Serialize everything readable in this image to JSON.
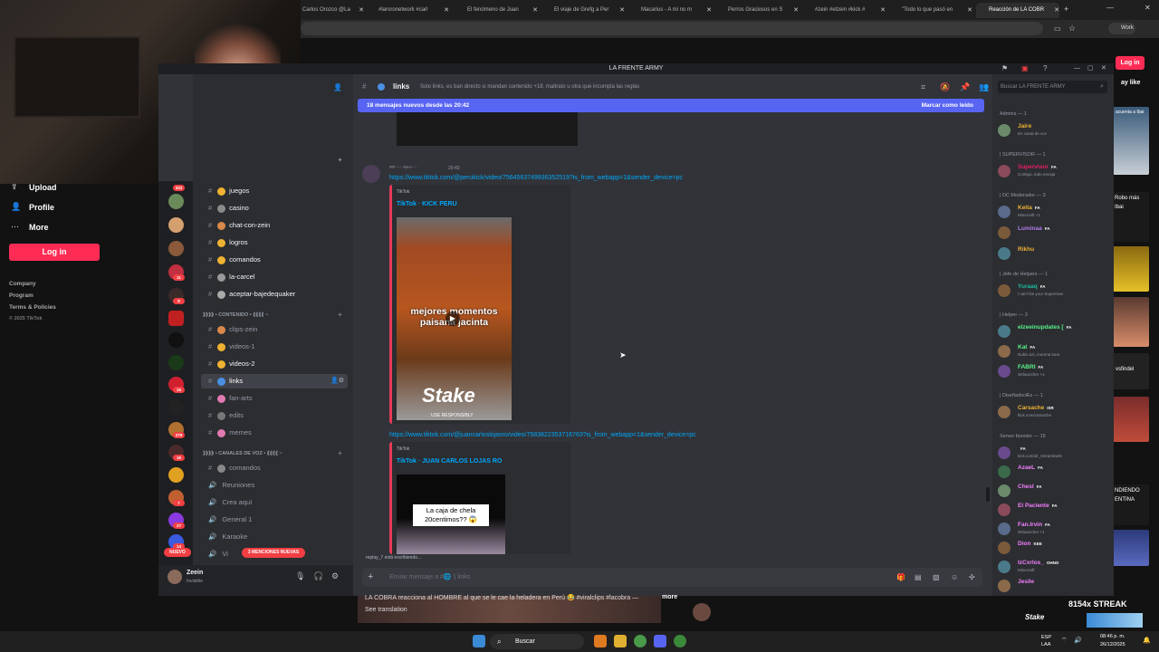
{
  "browser": {
    "tabs": [
      {
        "label": "Carlos Orozco @La"
      },
      {
        "label": "#laroronetwork #carl"
      },
      {
        "label": "El fenómeno de Juan"
      },
      {
        "label": "El viaje de Grefg a Per"
      },
      {
        "label": "Macarius - A mi no m"
      },
      {
        "label": "Perros Graciosos en S"
      },
      {
        "label": "#zein #elzein #kick #"
      },
      {
        "label": "\"Todo lo que pasó en"
      },
      {
        "label": "Reacción de LA COBR"
      }
    ],
    "profile_label": "Work",
    "login_label": "Log in"
  },
  "tiktok": {
    "nav": [
      {
        "label": "Upload",
        "icon": "upload-icon"
      },
      {
        "label": "Profile",
        "icon": "person-icon"
      },
      {
        "label": "More",
        "icon": "more-icon"
      }
    ],
    "login_button": "Log in",
    "footer": [
      "Company",
      "Program",
      "Terms & Policies",
      "© 2025 TikTok"
    ],
    "caption": "LA COBRA reacciona al HOMBRE al que se le cae la heladera en Perú 😂 #viralclips #lacobra —",
    "caption_more": "more",
    "see_translation": "See translation",
    "streak": "8154x STREAK",
    "right_thumbs": [
      "acuenta a Ibai",
      "ay like",
      "Robo más",
      "Ibai",
      "NDIENDO",
      "ENTINA",
      "vsfindel"
    ]
  },
  "discord": {
    "window_title": "LA FRENTE ARMY",
    "server_badges": [
      "333",
      "11",
      "8",
      "15",
      "279",
      "16",
      "7",
      "27",
      "14",
      "NUEVO"
    ],
    "categories": {
      "contenido": "⟫⟫⟫⟫ • CONTENIDO • ⟪⟪⟪⟪ ~",
      "voz": "⟫⟫⟫⟫ • CANALES DE VOZ • ⟪⟪⟪⟪ ~"
    },
    "channels_top": [
      {
        "name": "juegos",
        "icon": "hash"
      },
      {
        "name": "casino",
        "icon": "hash"
      },
      {
        "name": "chat-con-zein",
        "icon": "hash"
      },
      {
        "name": "logros",
        "icon": "hash"
      },
      {
        "name": "comandos",
        "icon": "hash"
      },
      {
        "name": "la-carcel",
        "icon": "hash"
      },
      {
        "name": "aceptar-bajedequaker",
        "icon": "hash"
      }
    ],
    "channels_content": [
      {
        "name": "clips-zein"
      },
      {
        "name": "videos-1"
      },
      {
        "name": "videos-2"
      },
      {
        "name": "links"
      },
      {
        "name": "fan-arts"
      },
      {
        "name": "edits"
      },
      {
        "name": "memes"
      }
    ],
    "channels_voice": [
      {
        "name": "comandos"
      },
      {
        "name": "Reuniones"
      },
      {
        "name": "Crea aquí"
      },
      {
        "name": "General 1"
      },
      {
        "name": "Karaoke"
      },
      {
        "name": "Vi"
      }
    ],
    "mentions_pill": "3 MENCIONES NUEVAS",
    "new_pill": "NUEVO",
    "user": {
      "name": "Zeein",
      "status": "Invisible"
    },
    "channel": {
      "name": "links",
      "topic": "Solo links, es ban directo si mandan contenido +18, maltrato u otra que incumpla las reglas"
    },
    "new_messages": {
      "text": "18 mensajes nuevos desde las 20:42",
      "action": "Marcar como leído"
    },
    "message": {
      "author": "ᴵᴬᴹ ⁻⁻ ᴬʲᵃᵘᵒ⁻⁻",
      "time": "20:43",
      "links": [
        {
          "url": "https://www.tiktok.com/@perukick/video/7564563749936352519?is_from_webapp=1&sender_device=pc",
          "provider": "TikTok",
          "title": "TikTok · KICK PERU",
          "overlay": "mejores momentos paisana jacinta",
          "brand": "Stake",
          "brand_sub": "USE RESPONSIBLY"
        },
        {
          "url": "https://www.tiktok.com/@juancarloslojasro/video/7583822353716763?is_from_webapp=1&sender_device=pc",
          "provider": "TikTok",
          "title": "TikTok · JUAN CARLOS LOJAS RO",
          "overlay": "La caja de chela 20centimos?? 😱"
        }
      ]
    },
    "typing": "replay_7 está escribiendo...",
    "input_placeholder": "Enviar mensaje a #🌐 ⟆ links",
    "members_search": "Buscar LA FRENTE ARMY",
    "member_sections": [
      {
        "title": "Admins — 1",
        "members": [
          {
            "name": "Jaire",
            "status": "En canal de voz",
            "color": "#f0b232"
          }
        ]
      },
      {
        "title": "| SUPERVISOR — 1",
        "members": [
          {
            "name": "Supervisor",
            "tag": "FA",
            "status": "Contigo, todo encaja",
            "color": "#e91e63"
          }
        ]
      },
      {
        "title": "| DC Moderador — 3",
        "members": [
          {
            "name": "Keita",
            "tag": "FA",
            "status": "Minecraft +1",
            "color": "#f0b232"
          },
          {
            "name": "Luminaa",
            "tag": "FA",
            "status": "",
            "color": "#b57bee"
          },
          {
            "name": "Rikhu",
            "tag": "",
            "status": "",
            "color": "#f0b232"
          }
        ]
      },
      {
        "title": "| Jefe de Helpers — 1",
        "members": [
          {
            "name": "Yuraaq",
            "tag": "FA",
            "status": "I can't be your Superman",
            "color": "#1abc9c"
          }
        ]
      },
      {
        "title": "| Helper — 3",
        "members": [
          {
            "name": "elzeeinupdates [",
            "tag": "FA",
            "status": "",
            "color": "#57f287"
          },
          {
            "name": "Kat",
            "tag": "FA",
            "status": "Nubis azi, morena luna",
            "color": "#57f287"
          },
          {
            "name": "FABRI",
            "tag": "FA",
            "status": "SKlauncher +1",
            "color": "#57f287"
          }
        ]
      },
      {
        "title": "| DiseñadorÆs — 1",
        "members": [
          {
            "name": "Carsache",
            "tag": "ISR",
            "status": "kick.com/carsache",
            "color": "#f0b232"
          }
        ]
      },
      {
        "title": "Server booster — 15",
        "members": [
          {
            "name": "",
            "tag": "FA",
            "status": "kick.com/dr_streamtanfe",
            "color": "#f47fff"
          },
          {
            "name": "AzaeL",
            "tag": "FA",
            "status": "",
            "color": "#f47fff"
          },
          {
            "name": "Chesl",
            "tag": "FA",
            "status": "",
            "color": "#f47fff"
          },
          {
            "name": "El Paciente",
            "tag": "FA",
            "status": "",
            "color": "#f47fff"
          },
          {
            "name": "Fan.Irvin",
            "tag": "FA",
            "status": "SKlauncher +1",
            "color": "#f47fff"
          },
          {
            "name": "Dion",
            "tag": "KEE",
            "status": "",
            "color": "#f47fff"
          },
          {
            "name": "IzCxrlos_",
            "tag": "OHNO",
            "status": "Minecraft",
            "color": "#f47fff"
          },
          {
            "name": "Jesile",
            "tag": "",
            "status": "",
            "color": "#f47fff"
          }
        ]
      }
    ]
  },
  "taskbar": {
    "search": "Buscar",
    "lang": "ESP",
    "lang2": "LAA",
    "time": "08:46 p. m.",
    "date": "26/12/2025"
  },
  "colors": {
    "discord_accent": "#5865f2",
    "tiktok_red": "#fe2c55",
    "link": "#00a8fc"
  }
}
